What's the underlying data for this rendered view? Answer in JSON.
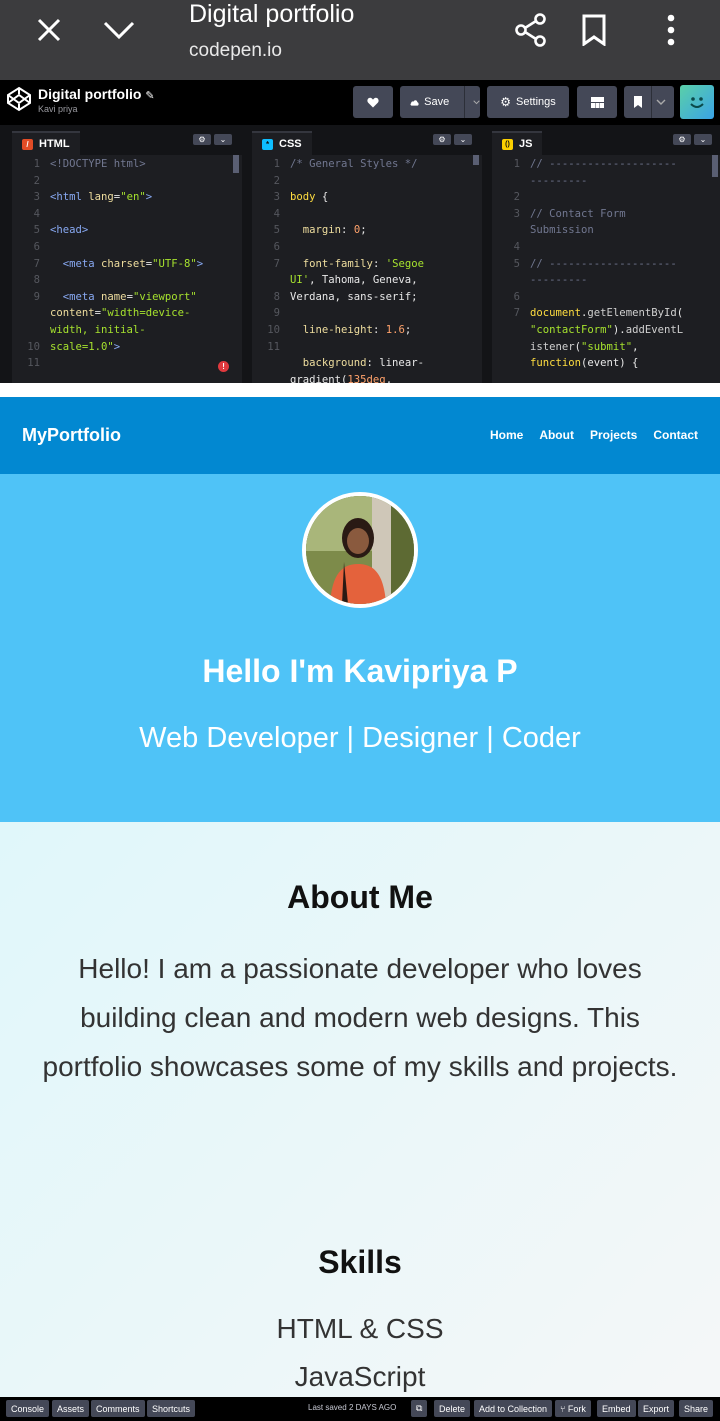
{
  "browser": {
    "title": "Digital portfolio",
    "url": "codepen.io",
    "icons": [
      "close-icon",
      "chevron-down-icon",
      "share-icon",
      "bookmark-icon",
      "more-vert-icon"
    ]
  },
  "codepen": {
    "pen_title": "Digital portfolio",
    "author": "Kavi priya",
    "save_label": "Save",
    "settings_label": "Settings"
  },
  "editors": {
    "html": {
      "label": "HTML",
      "line_numbers": [
        "1",
        "2",
        "3",
        "4",
        "5",
        "6",
        "7",
        "8",
        "9",
        "",
        "",
        "10",
        "11"
      ]
    },
    "css": {
      "label": "CSS",
      "line_numbers": [
        "1",
        "2",
        "3",
        "4",
        "5",
        "6",
        "7",
        "",
        "8",
        "9",
        "10",
        "11",
        ""
      ]
    },
    "js": {
      "label": "JS",
      "line_numbers": [
        "1",
        "",
        "2",
        "3",
        "",
        "4",
        "5",
        "",
        "6",
        "7",
        "",
        "",
        ""
      ]
    }
  },
  "preview": {
    "brand": "MyPortfolio",
    "nav": [
      "Home",
      "About",
      "Projects",
      "Contact"
    ],
    "hero_title": "Hello I'm Kavipriya P",
    "hero_subtitle": "Web Developer | Designer | Coder",
    "about_title": "About Me",
    "about_text": "Hello! I am a passionate developer who loves building clean and modern web designs. This portfolio showcases some of my skills and projects.",
    "skills_title": "Skills",
    "skills": [
      "HTML & CSS",
      "JavaScript"
    ]
  },
  "bottom_bar": {
    "left": [
      "Console",
      "Assets",
      "Comments",
      "Shortcuts"
    ],
    "saved_prefix": "Last saved",
    "saved_time": "2 DAYS AGO",
    "right": [
      "Delete",
      "Add to Collection",
      "Fork",
      "Embed",
      "Export",
      "Share"
    ]
  }
}
